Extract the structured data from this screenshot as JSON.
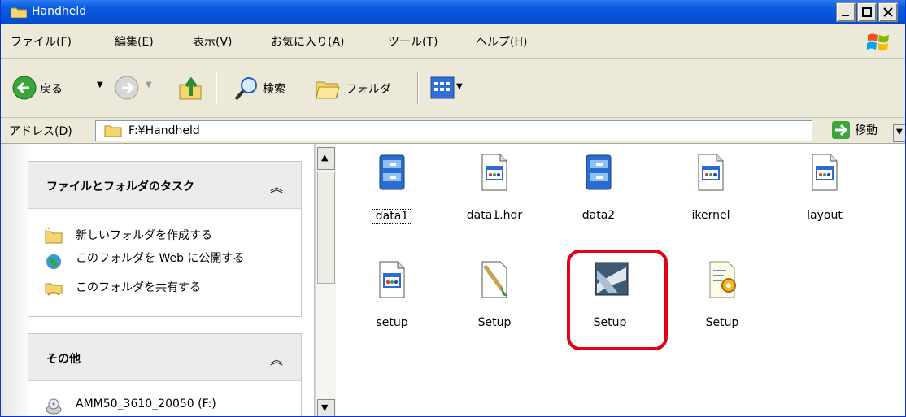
{
  "window": {
    "title": "Handheld"
  },
  "menu": [
    "ファイル(F)",
    "編集(E)",
    "表示(V)",
    "お気に入り(A)",
    "ツール(T)",
    "ヘルプ(H)"
  ],
  "toolbar": {
    "back": "戻る",
    "search": "検索",
    "folders": "フォルダ"
  },
  "address": {
    "label": "アドレス(D)",
    "value": "F:¥Handheld",
    "go": "移動"
  },
  "tasks": {
    "title": "ファイルとフォルダのタスク",
    "items": [
      "新しいフォルダを作成する",
      "このフォルダを Web に公開する",
      "このフォルダを共有する"
    ]
  },
  "other": {
    "title": "その他",
    "items": [
      "AMM50_3610_20050 (F:)"
    ]
  },
  "files": [
    {
      "name": "data1",
      "icon": "cab-icon"
    },
    {
      "name": "data1.hdr",
      "icon": "window-file-icon"
    },
    {
      "name": "data2",
      "icon": "cab-icon"
    },
    {
      "name": "ikernel",
      "icon": "window-file-icon"
    },
    {
      "name": "layout",
      "icon": "window-file-icon"
    },
    {
      "name": "setup",
      "icon": "window-file-icon"
    },
    {
      "name": "Setup",
      "icon": "paint-file-icon"
    },
    {
      "name": "Setup",
      "icon": "setup-exe-icon"
    },
    {
      "name": "Setup",
      "icon": "config-file-icon"
    }
  ],
  "colors": {
    "titlebar": "#0553d8",
    "highlight": "#e30012"
  }
}
